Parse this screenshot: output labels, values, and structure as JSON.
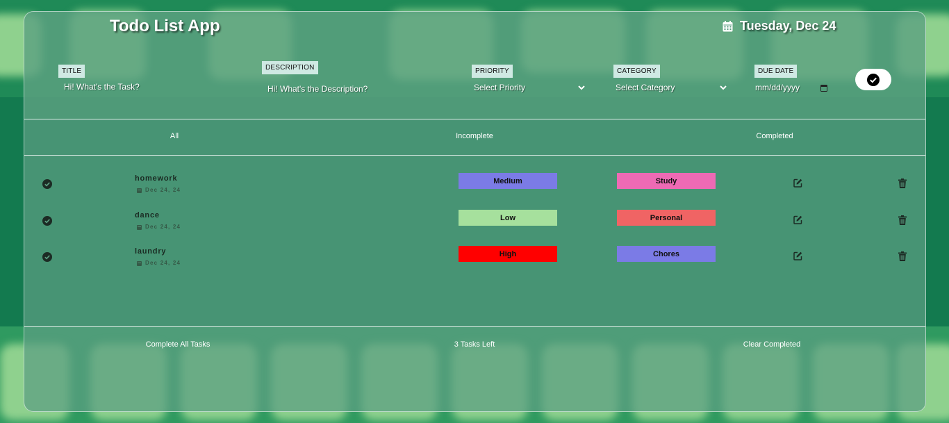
{
  "header": {
    "title": "Todo List App",
    "date": "Tuesday, Dec 24",
    "calendar_icon": "calendar-icon"
  },
  "form": {
    "title_label": "TITLE",
    "title_placeholder": "Hi! What's the Task?",
    "description_label": "DESCRIPTION",
    "description_placeholder": "Hi! What's the Description?",
    "priority_label": "PRIORITY",
    "priority_selected": "Select Priority",
    "category_label": "CATEGORY",
    "category_selected": "Select Category",
    "due_date_label": "DUE DATE",
    "due_date_placeholder": "mm/dd/yyyy",
    "submit_icon": "check-circle-icon"
  },
  "filters": [
    "All",
    "Incomplete",
    "Completed"
  ],
  "tasks": [
    {
      "title": "homework",
      "date": "Dec 24, 24",
      "priority": "Medium",
      "priority_color": "#7b7be6",
      "category": "Study",
      "category_color": "#ee6ab4"
    },
    {
      "title": "dance",
      "date": "Dec 24, 24",
      "priority": "Low",
      "priority_color": "#a6e09d",
      "category": "Personal",
      "category_color": "#f06464"
    },
    {
      "title": "laundry",
      "date": "Dec 24, 24",
      "priority": "High",
      "priority_color": "#ff0000",
      "category": "Chores",
      "category_color": "#7b7be6"
    }
  ],
  "footer": {
    "complete_all": "Complete All Tasks",
    "tasks_left": "3 Tasks Left",
    "clear_completed": "Clear Completed"
  }
}
